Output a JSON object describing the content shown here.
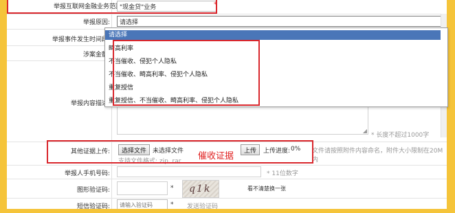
{
  "scope": {
    "label": "举报互联网金融业务范围:",
    "value": "\"现金贷\"业务"
  },
  "reason": {
    "label": "举报原因:",
    "value": "请选择"
  },
  "reason_options": [
    "请选择",
    "畸高利率",
    "不当催收、侵犯个人隐私",
    "不当催收、畸高利率、侵犯个人隐私",
    "重复授信",
    "重复授信、不当催收、畸高利率、侵犯个人隐私"
  ],
  "time": {
    "label": "举报事件发生时间段:"
  },
  "amount": {
    "label": "涉案金额:"
  },
  "description": {
    "label": "举报内容描述:",
    "hint": "* 长度不超过1000字"
  },
  "upload": {
    "label": "其他证据上传:",
    "choose_button": "选择文件",
    "no_file": "未选择文件",
    "upload_button": "上传",
    "progress_label": "上传进度:",
    "progress_value": "0%",
    "notice": "文件请按照附件内容命名，附件大小限制在20M内",
    "formats": "支持文件格式: zip, rar",
    "annotation": "催收证据"
  },
  "phone": {
    "label": "举报人手机号码:",
    "hint": "* 11位数字"
  },
  "captcha": {
    "label": "图形验证码:",
    "required": "*",
    "code": "q1k",
    "refresh": "看不清楚换一张"
  },
  "sms": {
    "label": "短信验证码:",
    "placeholder": "请输入验证码",
    "required": "*",
    "send": "发送验证码"
  },
  "colors": {
    "frame": "#f5c43a",
    "annotation": "#d9262c",
    "selected": "#4a76b8"
  }
}
